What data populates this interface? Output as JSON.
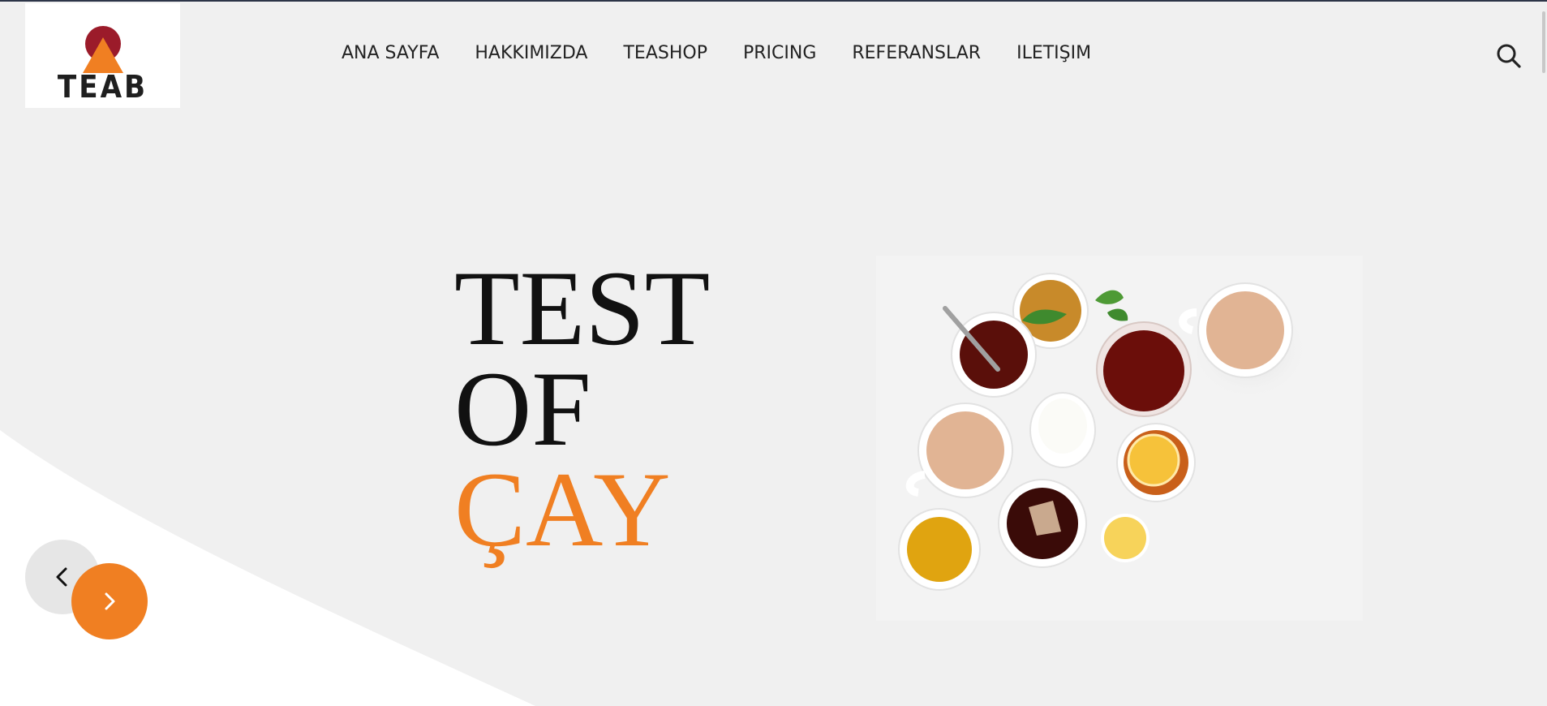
{
  "brand": {
    "logo_text": "TEAB",
    "colors": {
      "circle": "#9b1b2a",
      "triangle": "#f07f22",
      "text": "#1f1f1f"
    }
  },
  "nav": {
    "items": [
      {
        "label": "ANA SAYFA"
      },
      {
        "label": "HAKKIMIZDA"
      },
      {
        "label": "TEASHOP"
      },
      {
        "label": "PRICING"
      },
      {
        "label": "REFERANSLAR"
      },
      {
        "label": "ILETIŞIM"
      }
    ],
    "search_icon": "search-icon"
  },
  "hero": {
    "headline": {
      "line1": "TEST",
      "line2": "OF",
      "line3": "ÇAY"
    },
    "accent_color": "#f07f22",
    "image": "tea-cups-photo"
  },
  "slider": {
    "prev_icon": "chevron-left-icon",
    "next_icon": "chevron-right-icon"
  }
}
